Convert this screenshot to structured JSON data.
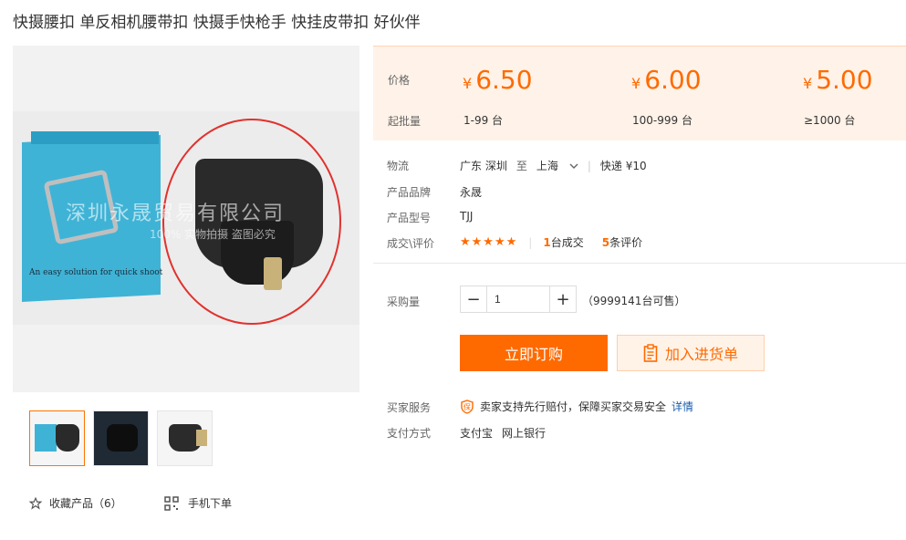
{
  "product": {
    "title": "快摄腰扣 单反相机腰带扣 快摄手快枪手 快挂皮带扣 好伙伴"
  },
  "gallery": {
    "watermark_line1": "深圳永晟贸易有限公司",
    "watermark_line2": "100% 实物拍摄 盗图必究",
    "box_caption": "An easy solution for quick shoot"
  },
  "pricing": {
    "price_label": "价格",
    "moq_label": "起批量",
    "currency": "¥",
    "tiers": [
      {
        "price": "6.50",
        "range": "1-99 台"
      },
      {
        "price": "6.00",
        "range": "100-999 台"
      },
      {
        "price": "5.00",
        "range": "≥1000 台"
      }
    ]
  },
  "info": {
    "logistics_label": "物流",
    "from": "广东 深圳",
    "to_word": "至",
    "to": "上海",
    "express": "快递 ¥10",
    "brand_label": "产品品牌",
    "brand": "永晟",
    "model_label": "产品型号",
    "model": "TJJ",
    "deals_label": "成交\\评价",
    "stars": "★★★★★",
    "deals_count": "1",
    "deals_text": "台成交",
    "reviews_count": "5",
    "reviews_text": "条评价"
  },
  "purchase": {
    "qty_label": "采购量",
    "qty_value": "1",
    "stock": "（9999141台可售）",
    "buy_now": "立即订购",
    "add_cart": "加入进货单"
  },
  "service": {
    "service_label": "买家服务",
    "service_text": "卖家支持先行赔付，保障买家交易安全",
    "details": "详情",
    "payment_label": "支付方式",
    "payment_1": "支付宝",
    "payment_2": "网上银行"
  },
  "footer": {
    "favorite": "收藏产品（6）",
    "mobile_order": "手机下单"
  },
  "colors": {
    "accent": "#ff6a00",
    "price_bg": "#fff2e8",
    "link": "#1a5cad"
  }
}
